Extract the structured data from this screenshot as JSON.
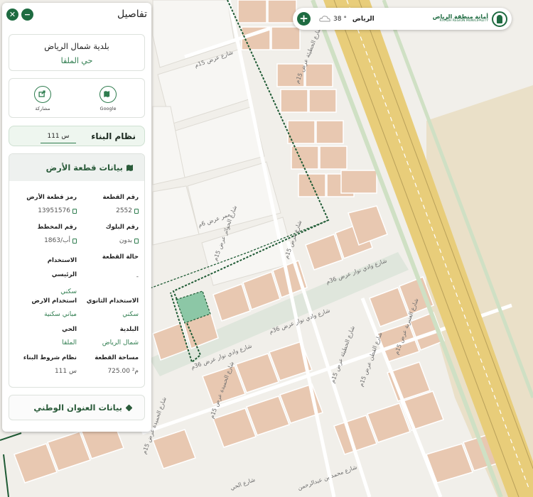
{
  "header": {
    "title": "تفاصيل",
    "city": "الرياض",
    "temperature": "38 °",
    "logo_ar": "أمانة منطقة الرياض",
    "logo_en": "RIYADH REGION MUNICIPALITY"
  },
  "location": {
    "municipality": "بلدية شمال الرياض",
    "district": "حي الملقا"
  },
  "actions": {
    "google": "Google",
    "share": "مشاركة"
  },
  "building_system": {
    "label": "نظام البناء",
    "value": "س 111"
  },
  "plot_section": {
    "title": "بيانات قطعة الأرض",
    "fields": {
      "plot_number": {
        "label": "رقم القطعة",
        "value": "2552"
      },
      "plot_code": {
        "label": "رمز قطعة الأرض",
        "value": "13951576"
      },
      "block_number": {
        "label": "رقم البلوك",
        "value": "بدون"
      },
      "plan_number": {
        "label": "رقم المخطط",
        "value": "1863/أب"
      },
      "plot_status": {
        "label": "حالة القطعة",
        "value": "-"
      },
      "main_use": {
        "label": "الاستخدام الرئيسي",
        "value": "سكني"
      },
      "secondary_use": {
        "label": "الاستخدام الثانوي",
        "value": "سكني"
      },
      "land_use": {
        "label": "استخدام الارض",
        "value": "مباني سكنية"
      },
      "municipality": {
        "label": "البلدية",
        "value": "شمال الرياض"
      },
      "district": {
        "label": "الحي",
        "value": "الملقا"
      },
      "area": {
        "label": "مساحة القطعة",
        "value": "725.00 م²"
      },
      "build_conditions": {
        "label": "نظام شروط البناء",
        "value": "س 111"
      }
    }
  },
  "address_section": {
    "title": "بيانات العنوان الوطني"
  },
  "map": {
    "street_labels": [
      "شارع عرض 15م",
      "شارع الحطيئة عرض 15م",
      "ممر عرض 6م",
      "شارع الحوائر عرض 15م",
      "شارع عرض 15م",
      "شارع وادي نوار عرض 36م",
      "شارع وادي نوار عرض 36م",
      "شارع وادي نوار عرض 36م",
      "شارع الحطيئة عرض 15م",
      "شارع القطن عرض 15م",
      "شارع الحميدة عرض 15م",
      "شارع العنبرية عرض 15م",
      "شارع محمد بن عبدالرحمن",
      "شارع الحميدة عرض 15م",
      "شارع الحي"
    ],
    "colors": {
      "background": "#f1efea",
      "block": "#f7f6f3",
      "building": "#e8c8b1",
      "highway": "#e8cd7a",
      "highway_line": "#b8a05a",
      "boundary": "#1e5a34",
      "selected_plot": "#8cc7a6",
      "park": "#eae0c8"
    }
  }
}
